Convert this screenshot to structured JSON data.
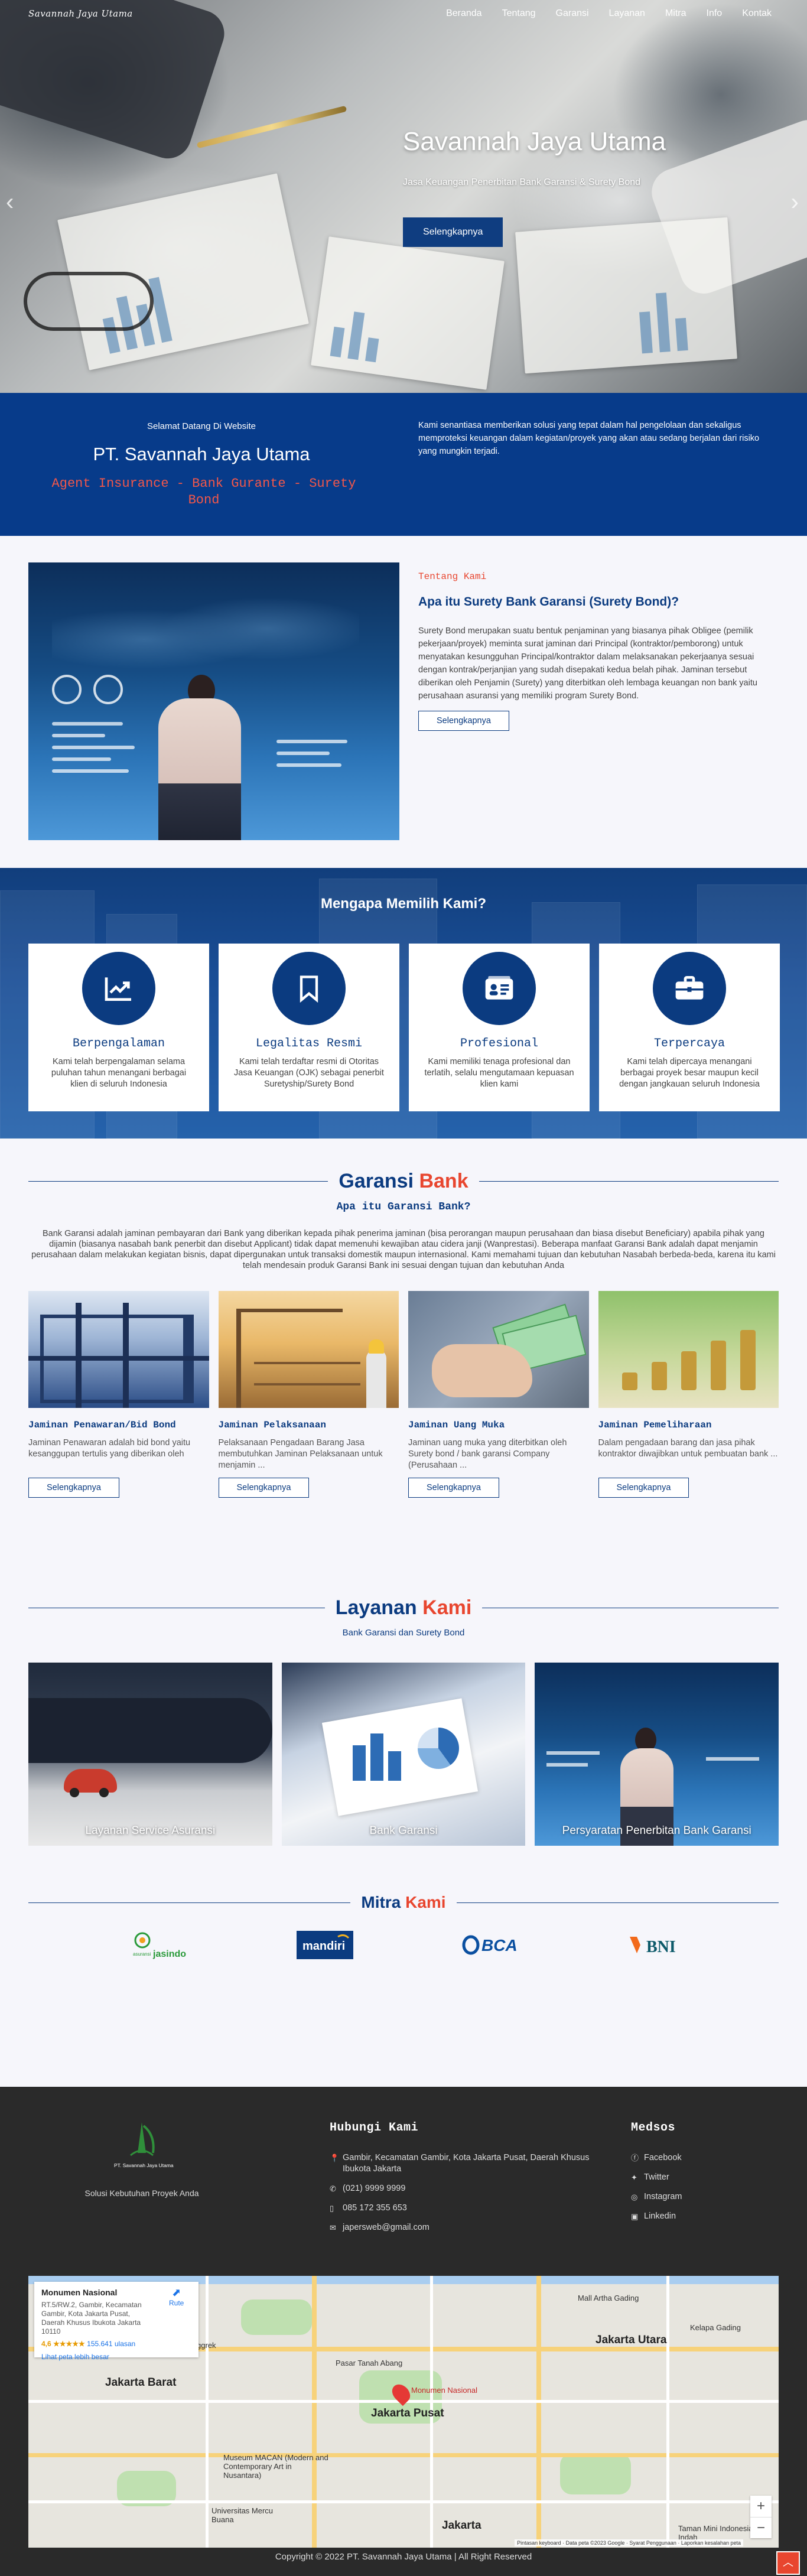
{
  "header": {
    "logo": "Savannah Jaya Utama",
    "nav": [
      "Beranda",
      "Tentang",
      "Garansi",
      "Layanan",
      "Mitra",
      "Info",
      "Kontak"
    ]
  },
  "hero": {
    "title": "Savannah Jaya Utama",
    "subtitle": "Jasa Keuangan Penerbitan Bank Garansi & Surety Bond",
    "button": "Selengkapnya"
  },
  "welcome": {
    "small": "Selamat Datang Di Website",
    "name": "PT. Savannah Jaya Utama",
    "tagline": "Agent Insurance - Bank Gurante - Surety Bond",
    "description": "Kami senantiasa memberikan solusi yang tepat dalam hal pengelolaan dan sekaligus memproteksi keuangan dalam kegiatan/proyek yang akan atau sedang berjalan dari risiko yang mungkin terjadi."
  },
  "about": {
    "label": "Tentang Kami",
    "title": "Apa itu Surety Bank Garansi (Surety Bond)?",
    "description": "Surety Bond merupakan suatu bentuk penjaminan yang biasanya pihak Obligee (pemilik pekerjaan/proyek) meminta surat jaminan dari Principal (kontraktor/pemborong) untuk menyatakan kesungguhan Principal/kontraktor dalam melaksanakan pekerjaanya sesuai dengan kontrak/perjanjian yang sudah disepakati kedua belah pihak. Jaminan tersebut diberikan oleh Penjamin (Surety) yang diterbitkan oleh lembaga keuangan non bank yaitu perusahaan asuransi yang memiliki program Surety Bond.",
    "button": "Selengkapnya"
  },
  "why": {
    "title": "Mengapa Memilih Kami?",
    "cards": [
      {
        "title": "Berpengalaman",
        "text": "Kami telah berpengalaman selama puluhan tahun menangani berbagai klien di seluruh Indonesia"
      },
      {
        "title": "Legalitas Resmi",
        "text": "Kami telah terdaftar resmi di Otoritas Jasa Keuangan (OJK) sebagai penerbit Suretyship/Surety Bond"
      },
      {
        "title": "Profesional",
        "text": "Kami memiliki tenaga profesional dan terlatih, selalu mengutamaan kepuasan klien kami"
      },
      {
        "title": "Terpercaya",
        "text": "Kami telah dipercaya menangani berbagai proyek besar maupun kecil dengan jangkauan seluruh Indonesia"
      }
    ]
  },
  "garansi": {
    "title_a": "Garansi",
    "title_b": "Bank",
    "subtitle": "Apa itu Garansi Bank?",
    "intro": "Bank Garansi adalah jaminan pembayaran dari Bank yang diberikan kepada pihak penerima jaminan (bisa perorangan maupun perusahaan dan biasa disebut Beneficiary) apabila pihak yang dijamin (biasanya nasabah bank penerbit dan disebut Applicant) tidak dapat memenuhi kewajiban atau cidera janji (Wanprestasi). Beberapa manfaat Garansi Bank adalah dapat menjamin perusahaan dalam melakukan kegiatan bisnis, dapat dipergunakan untuk transaksi domestik maupun internasional. Kami memahami tujuan dan kebutuhan Nasabah berbeda-beda, karena itu kami telah mendesain produk Garansi Bank ini sesuai dengan tujuan dan kebutuhan Anda",
    "cards": [
      {
        "title": "Jaminan Penawaran/Bid Bond",
        "text": "Jaminan Penawaran adalah bid bond yaitu kesanggupan tertulis yang diberikan oleh",
        "button": "Selengkapnya"
      },
      {
        "title": "Jaminan Pelaksanaan",
        "text": "Pelaksanaan Pengadaan Barang Jasa membutuhkan Jaminan Pelaksanaan untuk menjamin ...",
        "button": "Selengkapnya"
      },
      {
        "title": "Jaminan Uang Muka",
        "text": "Jaminan uang muka yang diterbitkan oleh Surety bond / bank garansi Company (Perusahaan ...",
        "button": "Selengkapnya"
      },
      {
        "title": "Jaminan Pemeliharaan",
        "text": "Dalam pengadaan barang dan jasa pihak kontraktor diwajibkan untuk pembuatan bank ...",
        "button": "Selengkapnya"
      }
    ]
  },
  "layanan": {
    "title_a": "Layanan",
    "title_b": "Kami",
    "subtitle": "Bank Garansi dan Surety Bond",
    "cards": [
      "Layanan Service Asuransi",
      "Bank Garansi",
      "Persyaratan Penerbitan Bank Garansi"
    ]
  },
  "mitra": {
    "title_a": "Mitra",
    "title_b": "Kami",
    "logos": [
      "asuransi jasindo",
      "mandiri",
      "BCA",
      "BNI"
    ]
  },
  "footer": {
    "brand_small": "PT. Savannah Jaya Utama",
    "tagline": "Solusi Kebutuhan Proyek Anda",
    "contact_title": "Hubungi Kami",
    "address": "Gambir, Kecamatan Gambir, Kota Jakarta Pusat, Daerah Khusus Ibukota Jakarta",
    "phone": "(021) 9999 9999",
    "mobile": "085 172 355 653",
    "email": "japersweb@gmail.com",
    "social_title": "Medsos",
    "social": [
      "Facebook",
      "Twitter",
      "Instagram",
      "Linkedin"
    ],
    "copyright": "Copyright © 2022 PT. Savannah Jaya Utama | All Right Reserved"
  },
  "map": {
    "place": "Monumen Nasional",
    "address": "RT.5/RW.2, Gambir, Kecamatan Gambir, Kota Jakarta Pusat, Daerah Khusus Ibukota Jakarta 10110",
    "rating": "4,6 ★★★★★",
    "reviews": "155.641 ulasan",
    "link": "Lihat peta lebih besar",
    "directions": "Rute",
    "labels": [
      "Jakarta Barat",
      "Jakarta Pusat",
      "Jakarta Utara",
      "Jakarta",
      "Monumen Nasional",
      "Taman Mini Indonesia Indah",
      "Mall Artha Gading",
      "Kelapa Gading",
      "Pasar Tanah Abang",
      "Mall Taman Anggrek",
      "Museum MACAN (Modern and Contemporary Art in Nusantara)",
      "Universitas Mercu Buana"
    ],
    "zoom_in": "+",
    "zoom_out": "−",
    "attribution": "Pintasan keyboard · Data peta ©2023 Google · Syarat Penggunaan · Laporkan kesalahan peta"
  },
  "colors": {
    "primary": "#0b3b80",
    "accent": "#e8462f",
    "footer": "#2a2a2a"
  }
}
